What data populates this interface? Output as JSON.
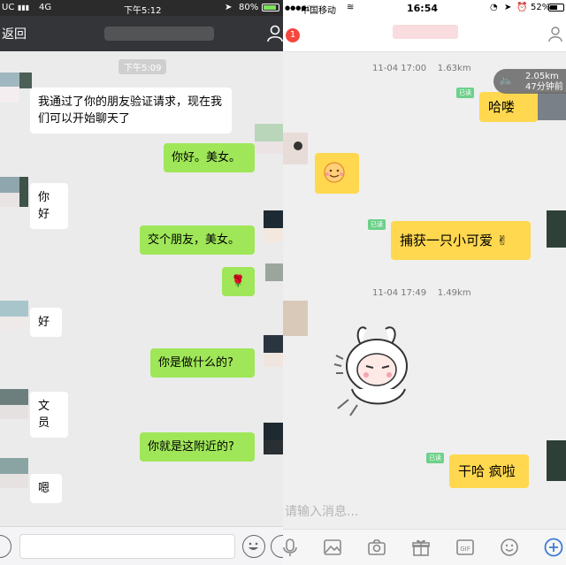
{
  "left": {
    "status": {
      "carrier": "UC",
      "network": "4G",
      "time": "下午5:12",
      "battery": "80%"
    },
    "nav": {
      "back_label": "返回"
    },
    "timestamp": "下午5:09",
    "messages": [
      {
        "side": "left",
        "text": "我通过了你的朋友验证请求，现在我们可以开始聊天了"
      },
      {
        "side": "right",
        "text": "你好。美女。"
      },
      {
        "side": "left",
        "text": "你好"
      },
      {
        "side": "right",
        "text": "交个朋友，美女。"
      },
      {
        "side": "right",
        "text": "🌹"
      },
      {
        "side": "left",
        "text": "好"
      },
      {
        "side": "right",
        "text": "你是做什么的?"
      },
      {
        "side": "left",
        "text": "文员"
      },
      {
        "side": "right",
        "text": "你就是这附近的?"
      },
      {
        "side": "left",
        "text": "嗯"
      }
    ],
    "input": {
      "placeholder": ""
    },
    "icons": [
      "voice-icon",
      "emoji-icon",
      "plus-icon"
    ],
    "colors": {
      "nav": "#333538",
      "green_bubble": "#9fe658",
      "background": "#ebebeb"
    }
  },
  "right": {
    "status": {
      "carrier": "中国移动",
      "time": "16:54",
      "battery": "52%"
    },
    "nav": {
      "badge_count": "1"
    },
    "meta1": {
      "time": "11-04 17:00",
      "distance": "1.63km"
    },
    "distance_chip": {
      "line1": "2.05km",
      "line2": "47分钟前"
    },
    "meta2": {
      "time": "11-04 17:49",
      "distance": "1.49km"
    },
    "messages": [
      {
        "side": "right",
        "text": "哈喽",
        "read": "已读"
      },
      {
        "side": "left",
        "type": "sticker",
        "sticker": "smiley-face"
      },
      {
        "side": "right",
        "text": "捕获一只小可爱 ✌",
        "read": "已读"
      },
      {
        "side": "left",
        "type": "sticker",
        "sticker": "bunny-character"
      },
      {
        "side": "right",
        "text": "干哈 疯啦",
        "read": "已读"
      }
    ],
    "input": {
      "placeholder": "请输入消息..."
    },
    "toolbar_icons": [
      "mic-icon",
      "image-icon",
      "camera-icon",
      "gift-icon",
      "gif-icon",
      "emoji-icon",
      "add-icon"
    ],
    "colors": {
      "yellow_bubble": "#ffd84f",
      "read_tag": "#6dd18a",
      "badge": "#f4473e"
    }
  }
}
